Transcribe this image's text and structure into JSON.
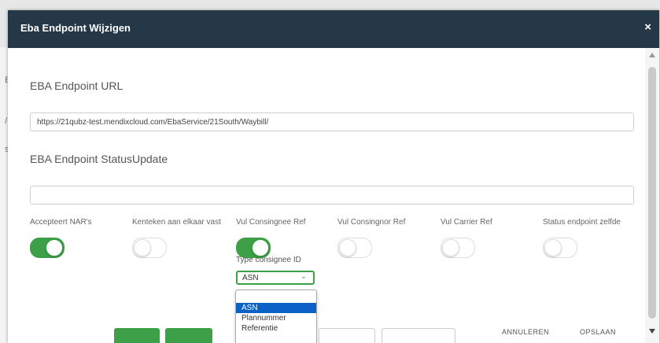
{
  "background": {
    "letters": [
      "E",
      "/",
      "s"
    ]
  },
  "dialog": {
    "title": "Eba Endpoint Wijzigen",
    "close_glyph": "×",
    "url_label": "EBA Endpoint URL",
    "url_value": "https://21qubz-test.mendixcloud.com/EbaService/21South/Waybill/",
    "status_label": "EBA Endpoint StatusUpdate",
    "status_value": "",
    "toggles": [
      {
        "label": "Accepteert NAR's",
        "on": true
      },
      {
        "label": "Kenteken aan elkaar vast",
        "on": false
      },
      {
        "label": "Vul Consingnee Ref",
        "on": true
      },
      {
        "label": "Vul Consingnor Ref",
        "on": false
      },
      {
        "label": "Vul Carrier Ref",
        "on": false
      },
      {
        "label": "Status endpoint zelfde",
        "on": false
      }
    ],
    "type_label": "Type consignee ID",
    "select_value": "ASN",
    "options": [
      "ASN",
      "Plannummer",
      "Referentie"
    ],
    "selected_option": "ASN",
    "footer": {
      "cancel_label": "ANNULEREN",
      "save_label": "OPSLAAN"
    }
  },
  "colors": {
    "header": "#243847",
    "accent": "#3d9f47",
    "selected": "#0b61c6"
  },
  "icons": {
    "close": "close-icon",
    "chevron": "chevron-down-icon"
  }
}
